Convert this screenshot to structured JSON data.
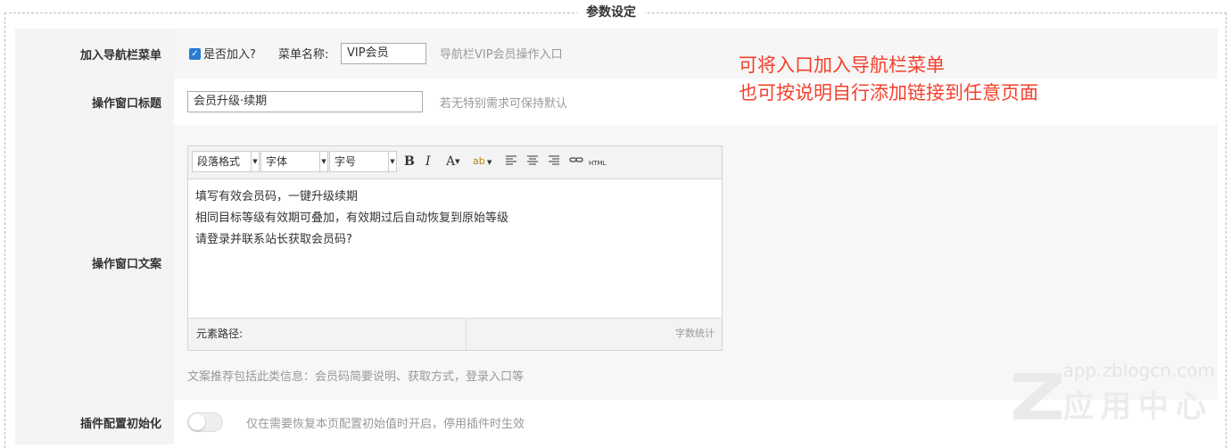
{
  "section_title": "参数设定",
  "rows": {
    "nav_menu": {
      "label": "加入导航栏菜单",
      "checkbox_label": "是否加入?",
      "menu_name_label": "菜单名称:",
      "menu_name_value": "VIP会员",
      "hint": "导航栏VIP会员操作入口"
    },
    "window_title": {
      "label": "操作窗口标题",
      "value": "会员升级·续期",
      "hint": "若无特别需求可保持默认"
    },
    "window_copy": {
      "label": "操作窗口文案",
      "toolbar": {
        "paragraph": "段落格式",
        "font": "字体",
        "size": "字号",
        "bold": "B",
        "italic": "I",
        "color": "A",
        "highlight": "ab",
        "html": "HTML"
      },
      "content_lines": [
        "填写有效会员码，一键升级续期",
        "相同目标等级有效期可叠加，有效期过后自动恢复到原始等级",
        "请登录并联系站长获取会员码?"
      ],
      "status_path": "元素路径:",
      "word_count": "字数统计",
      "hint": "文案推荐包括此类信息：会员码简要说明、获取方式，登录入口等"
    },
    "reset": {
      "label": "插件配置初始化",
      "hint": "仅在需要恢复本页配置初始值时开启，停用插件时生效",
      "toggle_on": false
    }
  },
  "annotation": {
    "line1": "可将入口加入导航栏菜单",
    "line2": "也可按说明自行添加链接到任意页面"
  },
  "watermark": {
    "url": "app.zblogcn.com",
    "text": "应用中心"
  },
  "colors": {
    "annotation": "#f5402c",
    "checkbox": "#2b7bd3"
  }
}
